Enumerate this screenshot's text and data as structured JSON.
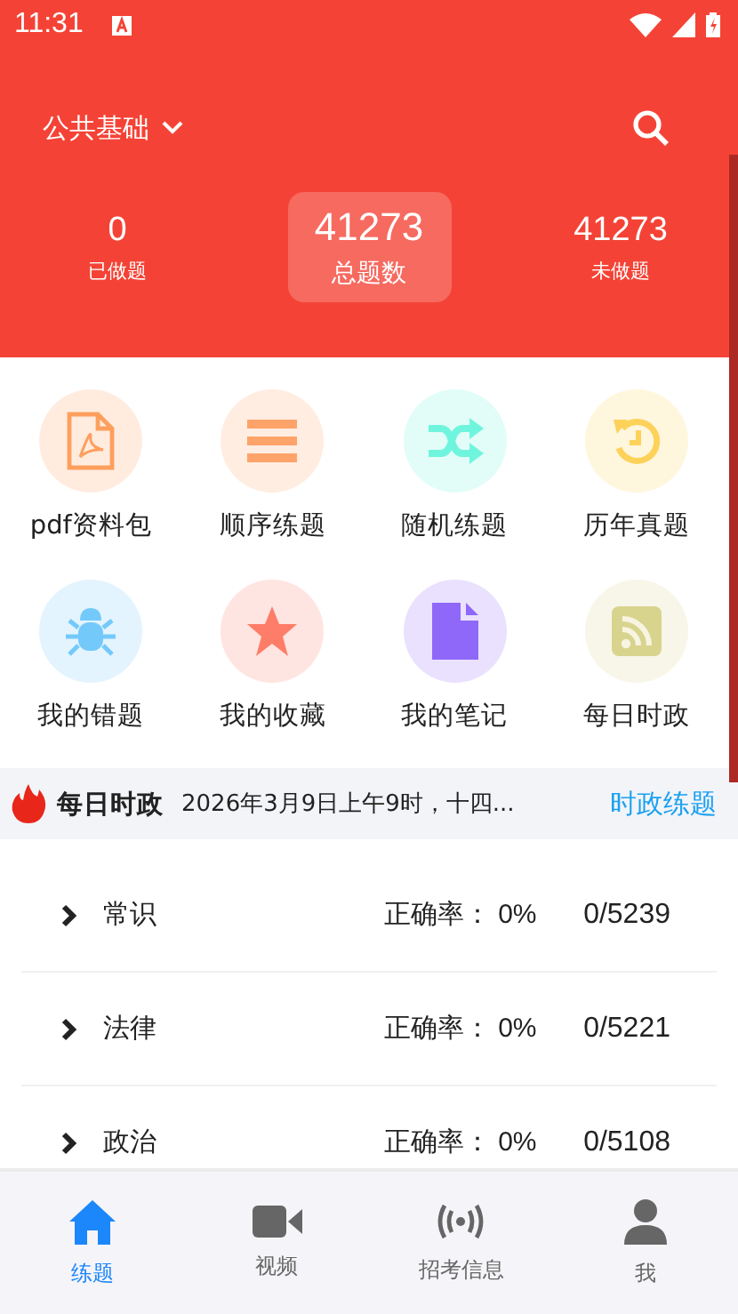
{
  "status_bar": {
    "time": "11:31"
  },
  "header": {
    "subject": "公共基础"
  },
  "stats": [
    {
      "value": "0",
      "label": "已做题",
      "selected": false
    },
    {
      "value": "41273",
      "label": "总题数",
      "selected": true
    },
    {
      "value": "41273",
      "label": "未做题",
      "selected": false
    }
  ],
  "shortcuts": [
    {
      "label": "pdf资料包",
      "kind": "pdf",
      "color": "#fe9f5e"
    },
    {
      "label": "顺序练题",
      "kind": "list",
      "color": "#fea36a"
    },
    {
      "label": "随机练题",
      "kind": "shuffle",
      "color": "#6ff5dd"
    },
    {
      "label": "历年真题",
      "kind": "history",
      "color": "#fdd25a"
    },
    {
      "label": "我的错题",
      "kind": "bug",
      "color": "#74c9fb"
    },
    {
      "label": "我的收藏",
      "kind": "star",
      "color": "#fe7d68"
    },
    {
      "label": "我的笔记",
      "kind": "note",
      "color": "#8f68f9"
    },
    {
      "label": "每日时政",
      "kind": "rss",
      "color": "#d8d48e"
    }
  ],
  "daily_news": {
    "title": "每日时政",
    "headline": "2026年3月9日上午9时，十四...",
    "link": "时政练题"
  },
  "categories": [
    {
      "name": "常识",
      "accuracy_label": "正确率：",
      "accuracy": "0%",
      "progress": "0/5239"
    },
    {
      "name": "法律",
      "accuracy_label": "正确率：",
      "accuracy": "0%",
      "progress": "0/5221"
    },
    {
      "name": "政治",
      "accuracy_label": "正确率：",
      "accuracy": "0%",
      "progress": "0/5108"
    }
  ],
  "tab_bar": [
    {
      "label": "练题",
      "kind": "home",
      "selected": true
    },
    {
      "label": "视频",
      "kind": "video",
      "selected": false
    },
    {
      "label": "招考信息",
      "kind": "broadcast",
      "selected": false
    },
    {
      "label": "我",
      "kind": "person",
      "selected": false
    }
  ]
}
